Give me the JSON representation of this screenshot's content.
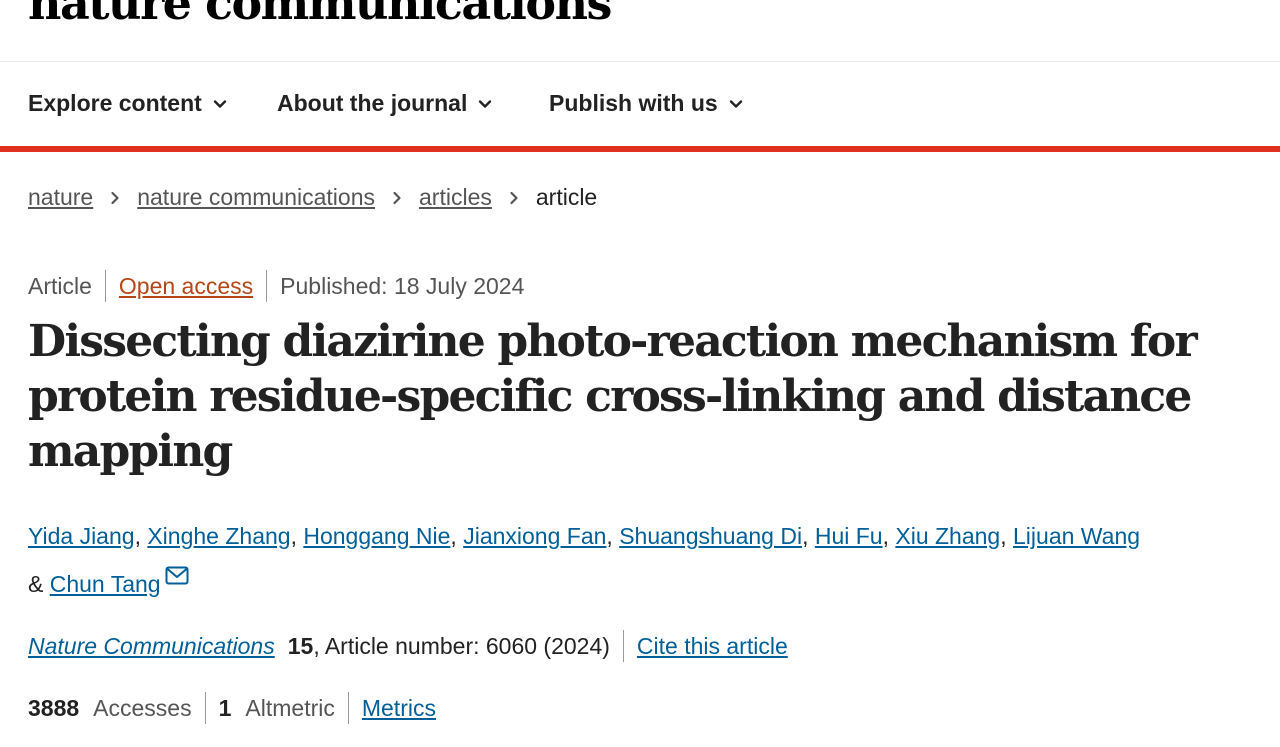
{
  "header": {
    "logo_text": "nature communications"
  },
  "nav": {
    "items": [
      {
        "label": "Explore content"
      },
      {
        "label": "About the journal"
      },
      {
        "label": "Publish with us"
      }
    ]
  },
  "breadcrumb": [
    "nature",
    "nature communications",
    "articles",
    "article"
  ],
  "article": {
    "type": "Article",
    "access": "Open access",
    "published": "Published: 18 July 2024",
    "title": "Dissecting diazirine photo-reaction mechanism for protein residue-specific cross-linking and distance mapping",
    "authors": [
      "Yida Jiang",
      "Xinghe Zhang",
      "Honggang Nie",
      "Jianxiong Fan",
      "Shuangshuang Di",
      "Hui Fu",
      "Xiu Zhang",
      "Lijuan Wang",
      "Chun Tang"
    ],
    "author_sep": ", ",
    "author_and": "& "
  },
  "citation": {
    "journal": "Nature Communications",
    "volume": "15",
    "details": ", Article number: 6060 (2024)",
    "cite_label": "Cite this article"
  },
  "metrics": {
    "accesses_value": "3888",
    "accesses_label": "Accesses",
    "altmetric_value": "1",
    "altmetric_label": "Altmetric",
    "metrics_link": "Metrics"
  },
  "colors": {
    "accent_red": "#e0301e",
    "link_blue": "#005f99",
    "open_access": "#b74616"
  },
  "icons": [
    "chevron-down-icon",
    "chevron-right-icon",
    "mail-icon"
  ]
}
